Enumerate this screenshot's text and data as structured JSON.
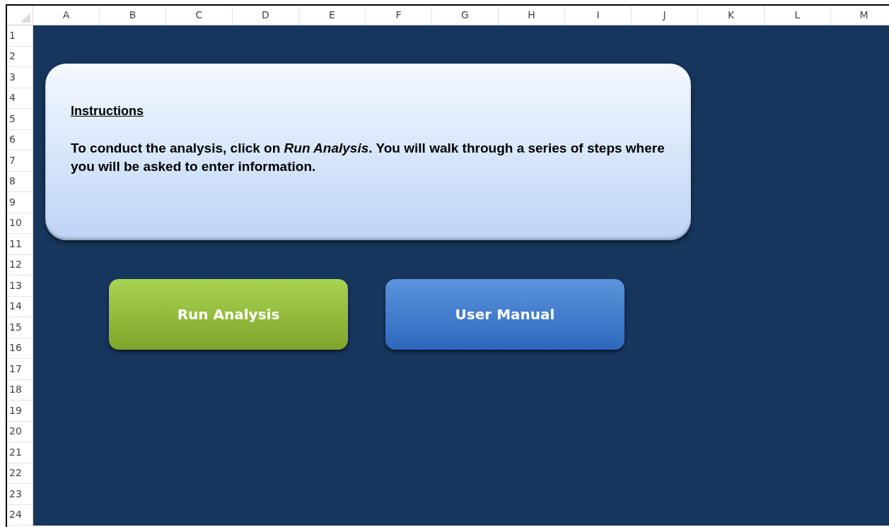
{
  "columns": [
    "A",
    "B",
    "C",
    "D",
    "E",
    "F",
    "G",
    "H",
    "I",
    "J",
    "K",
    "L",
    "M"
  ],
  "rows": [
    "1",
    "2",
    "3",
    "4",
    "5",
    "6",
    "7",
    "8",
    "9",
    "10",
    "11",
    "12",
    "13",
    "14",
    "15",
    "16",
    "17",
    "18",
    "19",
    "20",
    "21",
    "22",
    "23",
    "24"
  ],
  "instructions": {
    "heading": "Instructions",
    "text": "To conduct the analysis, click on *Run Analysis*. You will walk through a series of steps where you will be asked to enter information."
  },
  "buttons": [
    {
      "label": "Run Analysis",
      "kind": "green"
    },
    {
      "label": "User Manual",
      "kind": "blue"
    }
  ]
}
